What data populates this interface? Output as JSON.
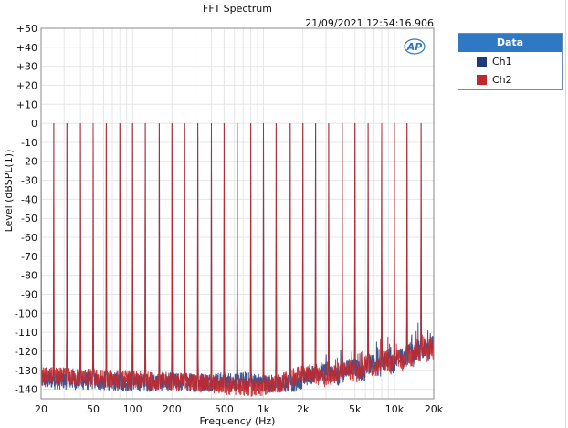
{
  "chart_data": {
    "type": "line",
    "title": "FFT Spectrum",
    "timestamp": "21/09/2021 12:54:16.906",
    "xlabel": "Frequency (Hz)",
    "ylabel": "Level (dBSPL(1))",
    "x_scale": "log",
    "xlim": [
      20,
      20000
    ],
    "ylim": [
      -145,
      50
    ],
    "x_ticks": [
      20,
      50,
      100,
      200,
      500,
      1000,
      2000,
      5000,
      10000,
      20000
    ],
    "x_tick_labels": [
      "20",
      "50",
      "100",
      "200",
      "500",
      "1k",
      "2k",
      "5k",
      "10k",
      "20k"
    ],
    "y_ticks": [
      50,
      40,
      30,
      20,
      10,
      0,
      -10,
      -20,
      -30,
      -40,
      -50,
      -60,
      -70,
      -80,
      -90,
      -100,
      -110,
      -120,
      -130,
      -140
    ],
    "y_tick_labels": [
      "+50",
      "+40",
      "+30",
      "+20",
      "+10",
      "0",
      "-10",
      "-20",
      "-30",
      "-40",
      "-50",
      "-60",
      "-70",
      "-80",
      "-90",
      "-100",
      "-110",
      "-120",
      "-130",
      "-140"
    ],
    "grid": true,
    "legend_position": "right",
    "tone_frequencies_hz": [
      20,
      25,
      31.5,
      40,
      50,
      63,
      80,
      100,
      125,
      160,
      200,
      250,
      315,
      400,
      500,
      630,
      800,
      1000,
      1250,
      1600,
      2000,
      2500,
      3150,
      4000,
      5000,
      6300,
      8000,
      10000,
      12500,
      16000
    ],
    "tone_peak_level_db": 0,
    "noise_floor": {
      "frequencies_hz": [
        20,
        50,
        100,
        500,
        1000,
        2000,
        5000,
        10000,
        20000
      ],
      "level_db": [
        -135,
        -136,
        -137,
        -138,
        -137,
        -134,
        -130,
        -125,
        -118
      ]
    },
    "series": [
      {
        "name": "Ch1",
        "color": "#1f3a7a"
      },
      {
        "name": "Ch2",
        "color": "#c0282d"
      }
    ]
  },
  "legend": {
    "title": "Data",
    "items": [
      {
        "label": "Ch1",
        "color": "#1f3a7a"
      },
      {
        "label": "Ch2",
        "color": "#c0282d"
      }
    ]
  },
  "logo_text": "AP"
}
